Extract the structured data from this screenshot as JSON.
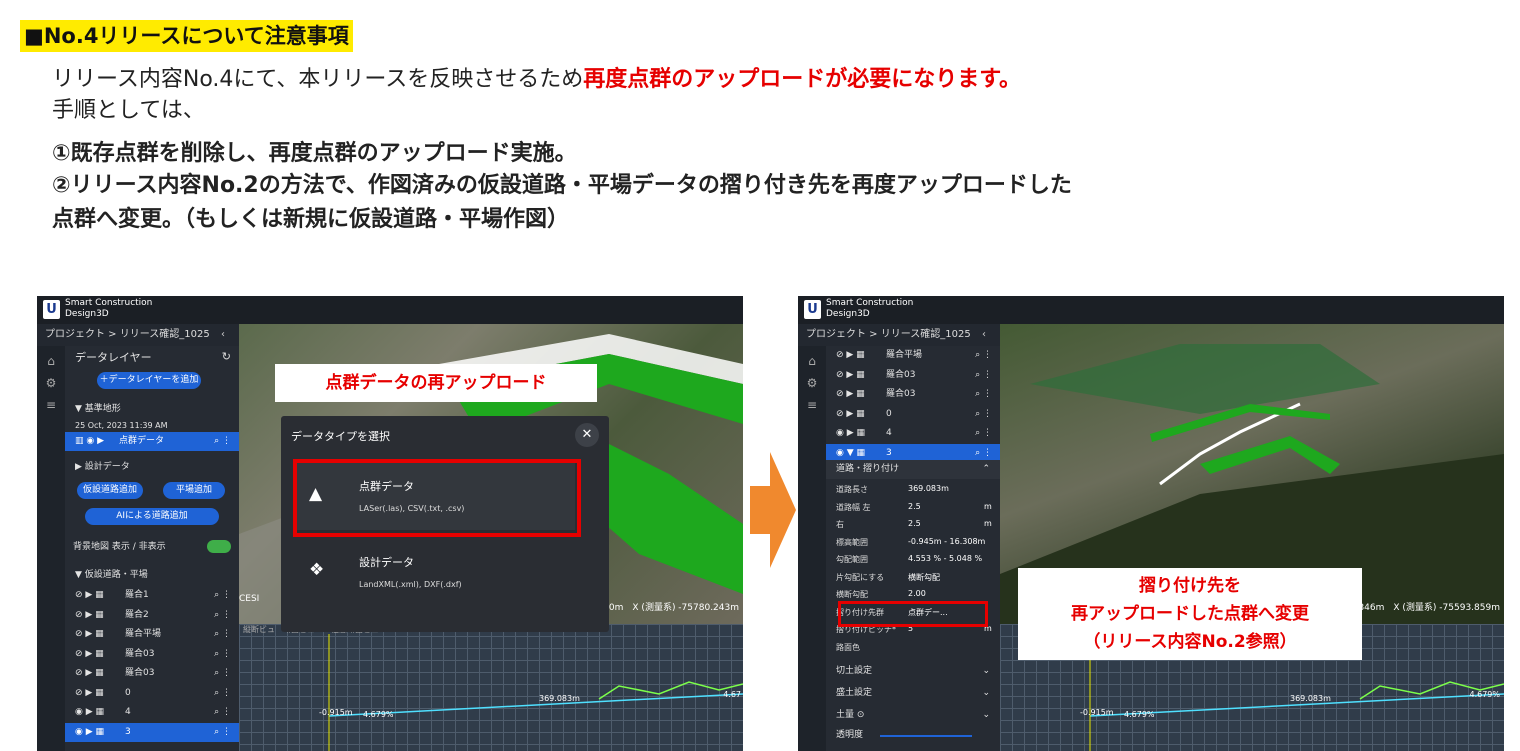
{
  "heading": "■No.4リリースについて注意事項",
  "line1_normal": "リリース内容No.4にて、本リリースを反映させるため",
  "line1_red": "再度点群のアップロードが必要になります。",
  "line2": "手順としては、",
  "line3": "①既存点群を削除し、再度点群のアップロード実施。",
  "line4": "②リリース内容No.2の方法で、作図済みの仮設道路・平場データの摺り付き先を再度アップロードした",
  "line5": "点群へ変更。（もしくは新規に仮設道路・平場作図）",
  "app": {
    "brand_line1": "Smart Construction",
    "brand_line2": "Design3D",
    "breadcrumb": "プロジェクト > リリース確認_1025",
    "logo": "U"
  },
  "left": {
    "panel_title": "データレイヤー",
    "add_layer_button": "＋データレイヤーを追加",
    "base_terrain": "▼ 基準地形",
    "timestamp": "25 Oct, 2023 11:39 AM",
    "pointcloud_row": "点群データ",
    "design_data": "▶ 設計データ",
    "add_road_button": "仮設道路追加",
    "add_flat_button": "平場追加",
    "ai_road_button": "AIによる道路追加",
    "basemap_toggle": "背景地図 表示 / 非表示",
    "temp_section": "▼ 仮設道路・平場",
    "layers": [
      "羅合1",
      "羅合2",
      "羅合平場",
      "羅合03",
      "羅合03",
      "0",
      "4",
      "3"
    ],
    "callout": "点群データの再アップロード",
    "dialog_title": "データタイプを選択",
    "dialog_close": "✕",
    "option1_title": "点群データ",
    "option1_sub": "LASer(.las), CSV(.txt, .csv)",
    "option2_title": "設計データ",
    "option2_sub": "LandXML(.xml), DXF(.dxf)",
    "coord": ".680m　X (測量系) -75780.243m",
    "cesium": "CESI",
    "profile_label1": "-0.915m",
    "profile_label2": "4.679%",
    "profile_label3": "369.083m",
    "profile_label4": "4.67",
    "tabs": [
      "縦断ビュ",
      "断面ビュー",
      "任意断面ビュー"
    ]
  },
  "right": {
    "layers": [
      "羅合平場",
      "羅合03",
      "羅合03",
      "0",
      "4",
      "3"
    ],
    "section": "道路・摺り付け",
    "props": [
      {
        "k": "道路長さ",
        "v": "369.083m"
      },
      {
        "k": "道路幅 左",
        "v": "2.5",
        "u": "m"
      },
      {
        "k": "右",
        "v": "2.5",
        "u": "m"
      },
      {
        "k": "標高範囲",
        "v": "-0.945m - 16.308m"
      },
      {
        "k": "勾配範囲",
        "v": "4.553 % - 5.048 %"
      },
      {
        "k": "片勾配にする",
        "v": "横断勾配"
      },
      {
        "k": "横断勾配",
        "v": "2.00"
      },
      {
        "k": "摺り付け先群",
        "v": "点群デー..."
      },
      {
        "k": "摺り付けピッチ*",
        "v": "5",
        "u": "m"
      },
      {
        "k": "路面色",
        "v": ""
      }
    ],
    "cut": "切土設定",
    "fill": "盛土設定",
    "soil": "土量",
    "opacity": "透明度",
    "callout_lines": [
      "摺り付け先を",
      "再アップロードした点群へ変更",
      "（リリース内容No.2参照）"
    ],
    "coord": "30.346m　X (測量系) -75593.859m",
    "profile_label1": "-0.915m",
    "profile_label2": "4.679%",
    "profile_label3": "369.083m",
    "profile_label4": "4.679%"
  },
  "colors": {
    "highlight": "#ffeb00",
    "accent_red": "#e60000",
    "select_blue": "#1f63d6",
    "arrow": "#f0892e",
    "road_green": "#1ea81e"
  }
}
